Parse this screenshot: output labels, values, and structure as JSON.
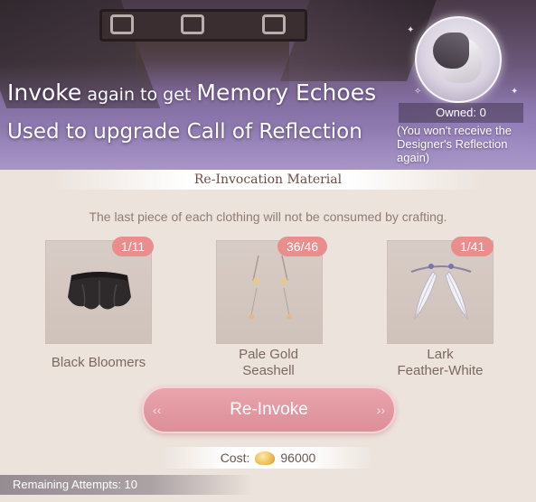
{
  "banner": {
    "line1_big1": "Invoke",
    "line1_small": " again to get ",
    "line1_big2": "Memory Echoes",
    "line2": "Used to upgrade Call of Reflection",
    "owned": "Owned: 0",
    "note": "(You won't receive the Designer's Reflection again)"
  },
  "material": {
    "title": "Re-Invocation Material",
    "hint": "The last piece of each clothing will not be consumed by crafting.",
    "items": [
      {
        "name": "Black Bloomers",
        "count": "1/11",
        "icon": "black-bloomers-icon"
      },
      {
        "name": "Pale Gold\nSeashell",
        "count": "36/46",
        "icon": "seashell-earrings-icon"
      },
      {
        "name": "Lark\nFeather-White",
        "count": "1/41",
        "icon": "feather-earrings-icon"
      }
    ]
  },
  "action": {
    "button": "Re-Invoke",
    "cost_label": "Cost:",
    "cost_value": "96000",
    "cost_icon": "gold-coin-icon",
    "remaining": "Remaining Attempts: 10"
  },
  "colors": {
    "badge": "#e98d8d",
    "button": "#e09aa3",
    "background": "#ece3dc"
  }
}
